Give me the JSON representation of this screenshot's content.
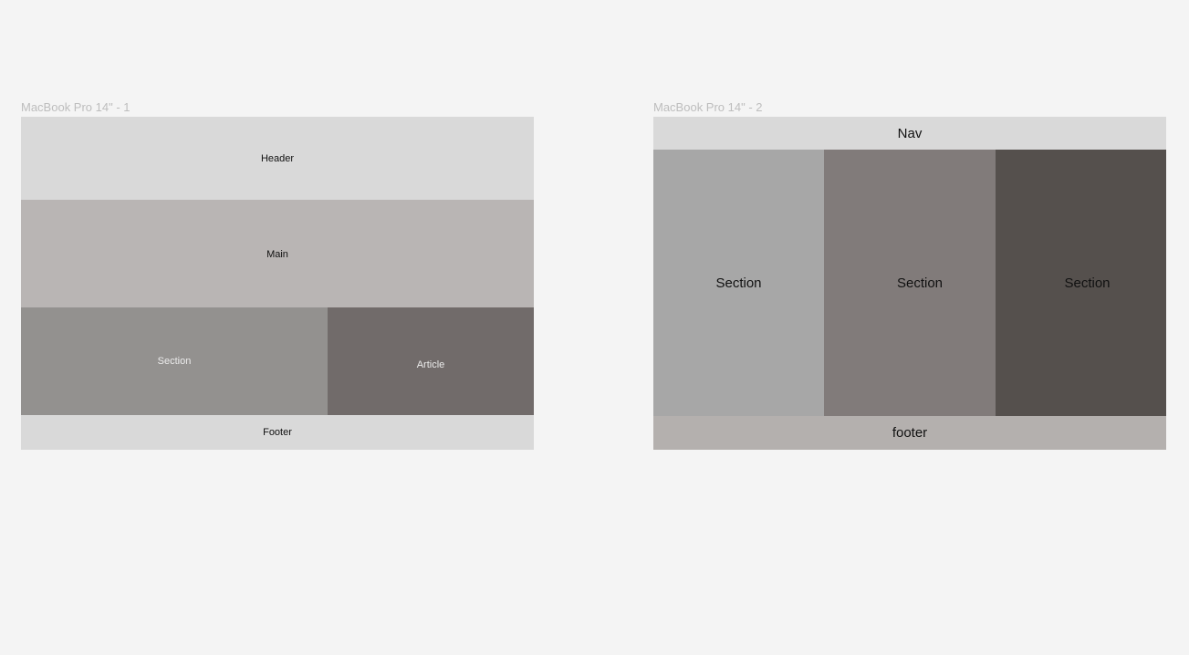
{
  "canvas": {
    "background": "#f4f4f4"
  },
  "frames": [
    {
      "title": "MacBook Pro 14\" - 1",
      "blocks": {
        "header": {
          "label": "Header",
          "color": "#d9d9d9"
        },
        "main": {
          "label": "Main",
          "color": "#b9b5b4"
        },
        "section": {
          "label": "Section",
          "color": "#93918f"
        },
        "article": {
          "label": "Article",
          "color": "#716b6a"
        },
        "footer": {
          "label": "Footer",
          "color": "#d9d9d9"
        }
      }
    },
    {
      "title": "MacBook Pro 14\" - 2",
      "blocks": {
        "nav": {
          "label": "Nav",
          "color": "#d9d9d9"
        },
        "section1": {
          "label": "Section",
          "color": "#a7a7a7"
        },
        "section2": {
          "label": "Section",
          "color": "#817b7a"
        },
        "section3": {
          "label": "Section",
          "color": "#55504d"
        },
        "footer": {
          "label": "footer",
          "color": "#b4b0ae"
        }
      }
    }
  ]
}
